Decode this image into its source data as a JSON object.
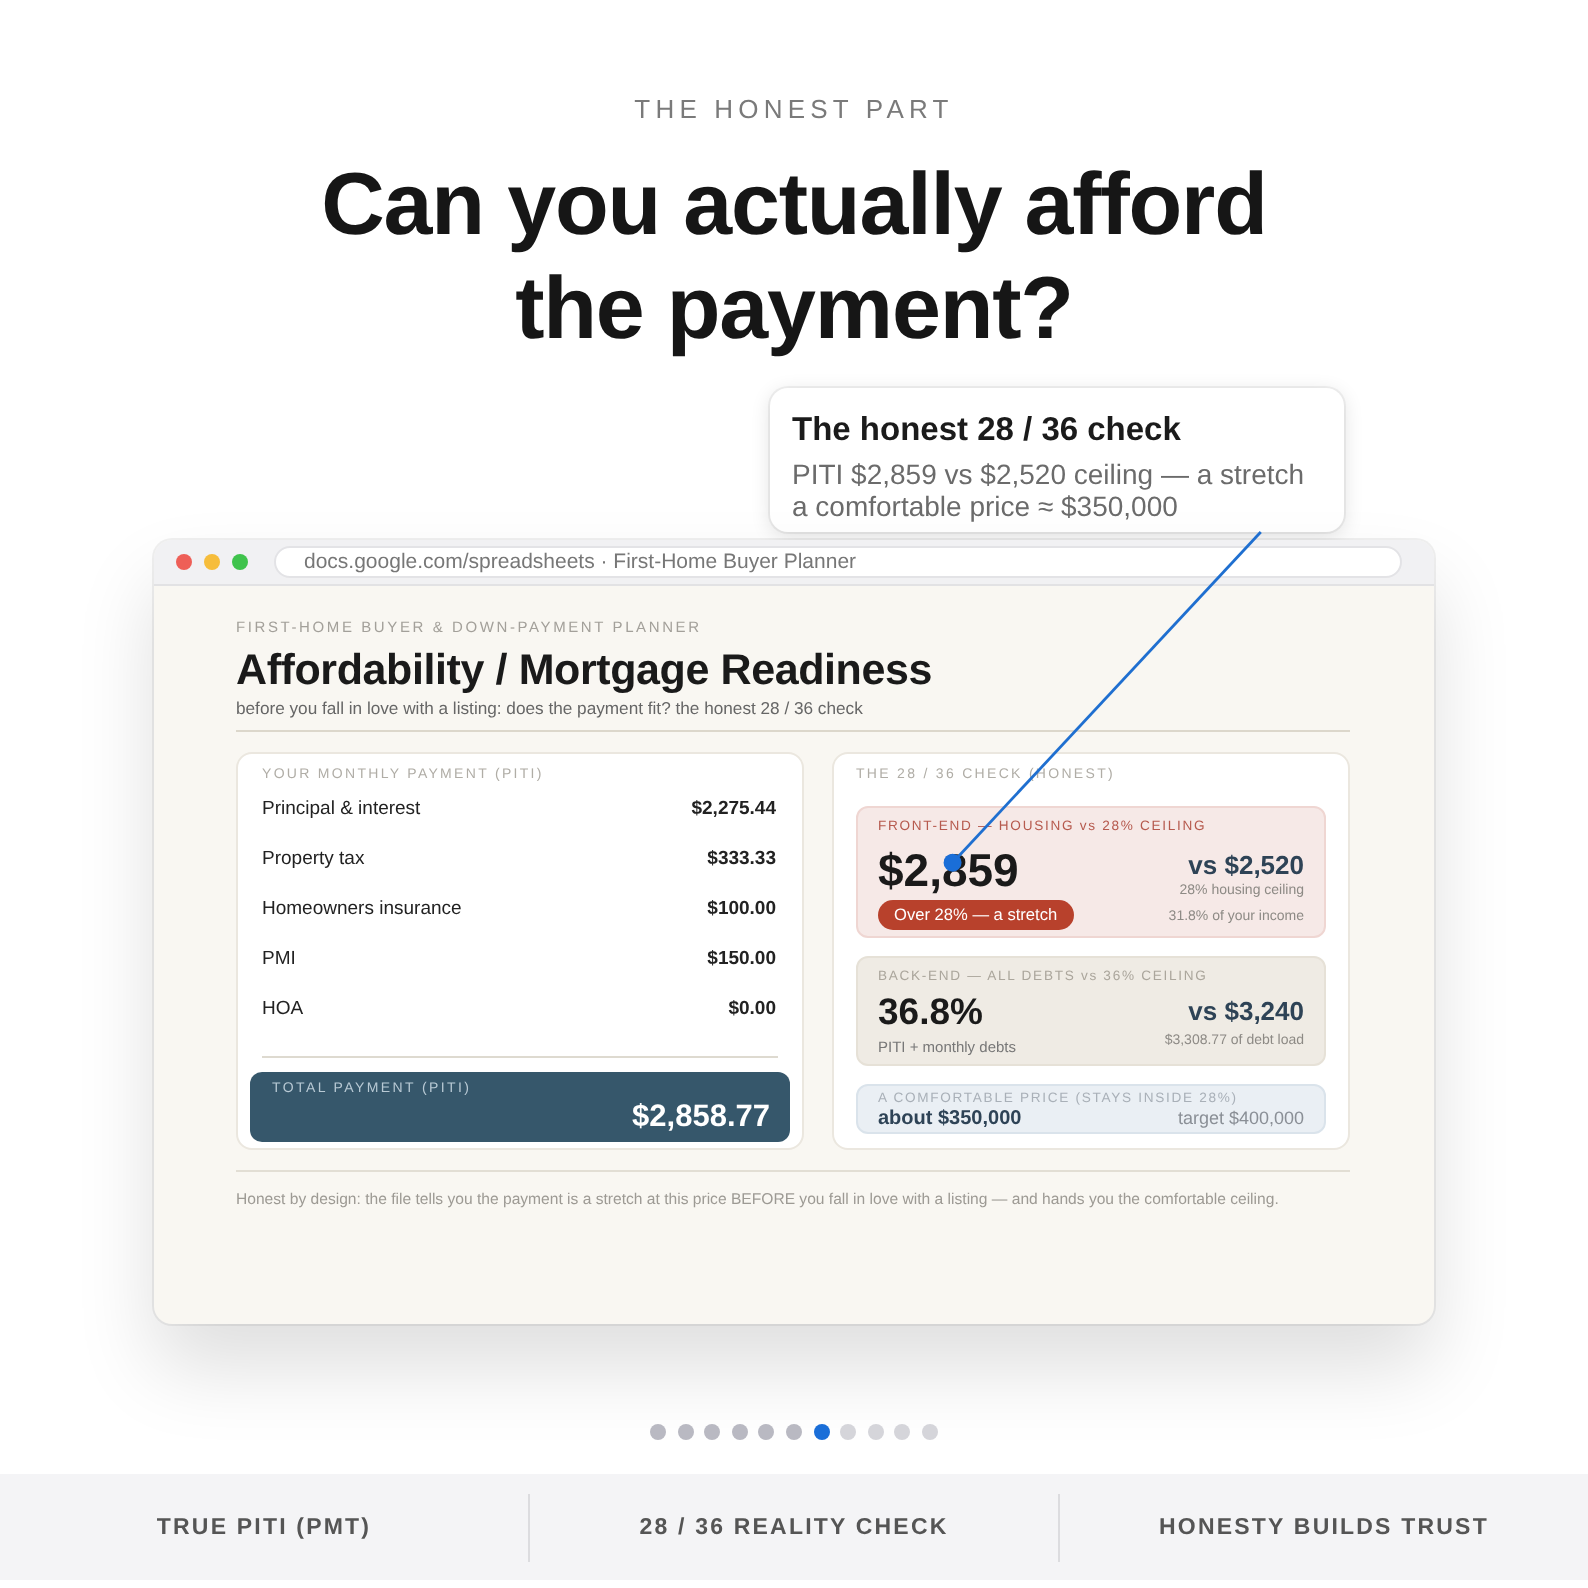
{
  "eyebrow": "THE HONEST PART",
  "headline": "Can you actually afford the payment?",
  "tooltip": {
    "title": "The honest 28 / 36 check",
    "lines": [
      "PITI $2,859 vs $2,520 ceiling — a stretch",
      "a comfortable price ≈ $350,000"
    ]
  },
  "browser": {
    "address": "docs.google.com/spreadsheets · First-Home Buyer Planner"
  },
  "sheet": {
    "eyebrow": "FIRST-HOME BUYER & DOWN-PAYMENT PLANNER",
    "title": "Affordability / Mortgage Readiness",
    "subtitle": "before you fall in love with a listing: does the payment fit? the honest 28 / 36 check",
    "payment_card": {
      "heading": "YOUR MONTHLY PAYMENT (PITI)",
      "rows": [
        {
          "label": "Principal & interest",
          "value": "$2,275.44"
        },
        {
          "label": "Property tax",
          "value": "$333.33"
        },
        {
          "label": "Homeowners insurance",
          "value": "$100.00"
        },
        {
          "label": "PMI",
          "value": "$150.00"
        },
        {
          "label": "HOA",
          "value": "$0.00"
        }
      ],
      "total": {
        "label": "TOTAL PAYMENT (PITI)",
        "value": "$2,858.77"
      }
    },
    "check_card": {
      "heading": "THE 28 / 36 CHECK (HONEST)",
      "panels": [
        {
          "kind": "alert",
          "label": "FRONT-END — HOUSING vs 28% CEILING",
          "value": "$2,859",
          "badge": "Over 28% — a stretch",
          "compare": "vs $2,520",
          "notes": [
            "28% housing ceiling",
            "31.8% of your income"
          ]
        },
        {
          "kind": "neutral",
          "label": "BACK-END — ALL DEBTS vs 36% CEILING",
          "value": "36.8%",
          "sub": "PITI + monthly debts",
          "compare": "vs $3,240",
          "notes": [
            "$3,308.77 of debt load"
          ]
        },
        {
          "kind": "info",
          "label": "A COMFORTABLE PRICE (STAYS INSIDE 28%)",
          "value": "about $350,000",
          "compare": "target $400,000"
        }
      ]
    },
    "note": "Honest by design: the file tells you the payment is a stretch at this price BEFORE you fall in love with a listing — and hands you the comfortable ceiling."
  },
  "pager": [
    {
      "selected": false,
      "visited": true
    },
    {
      "selected": false,
      "visited": true
    },
    {
      "selected": false,
      "visited": true
    },
    {
      "selected": false,
      "visited": true
    },
    {
      "selected": false,
      "visited": true
    },
    {
      "selected": false,
      "visited": true
    },
    {
      "selected": true,
      "visited": true
    },
    {
      "selected": false,
      "visited": false
    },
    {
      "selected": false,
      "visited": false
    },
    {
      "selected": false,
      "visited": false
    },
    {
      "selected": false,
      "visited": false
    }
  ],
  "features": [
    "TRUE PITI (PMT)",
    "28 / 36 REALITY CHECK",
    "HONESTY BUILDS TRUST"
  ]
}
